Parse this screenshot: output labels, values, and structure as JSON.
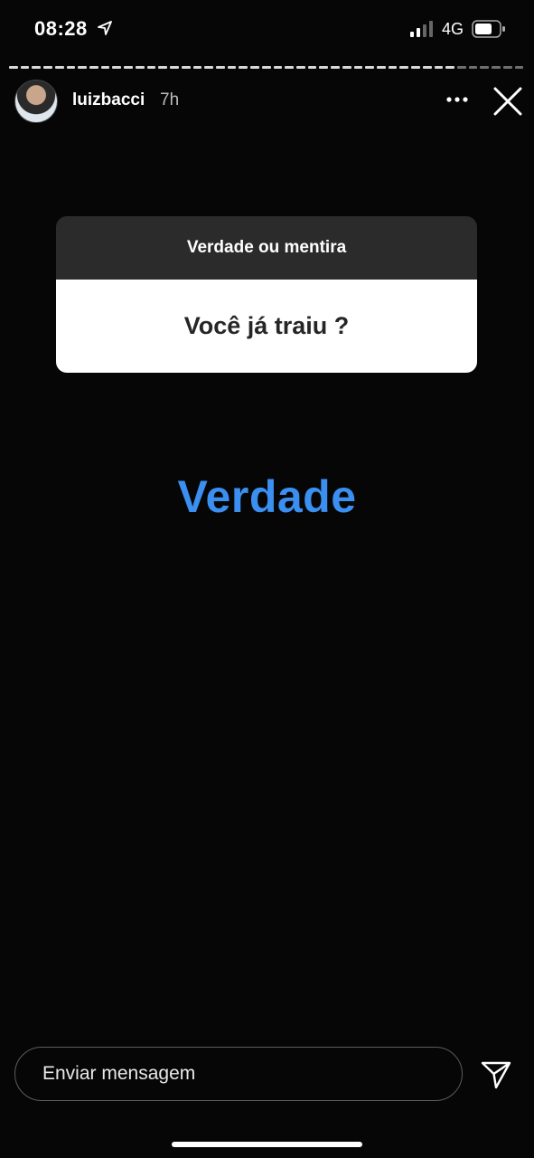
{
  "status_bar": {
    "time": "08:28",
    "network": "4G",
    "icons": [
      "location-arrow-icon",
      "signal-icon",
      "battery-icon"
    ]
  },
  "story": {
    "username": "luizbacci",
    "time": "7h",
    "progress_segments_total": 45,
    "progress_segments_seen": 39
  },
  "question_card": {
    "title": "Verdade ou mentira",
    "question": "Você já traiu ?"
  },
  "answer": {
    "text": "Verdade",
    "color": "#3b8ff0"
  },
  "footer": {
    "message_placeholder": "Enviar mensagem"
  },
  "colors": {
    "background": "#060606",
    "card_header": "#2b2b2b",
    "card_body": "#ffffff"
  }
}
